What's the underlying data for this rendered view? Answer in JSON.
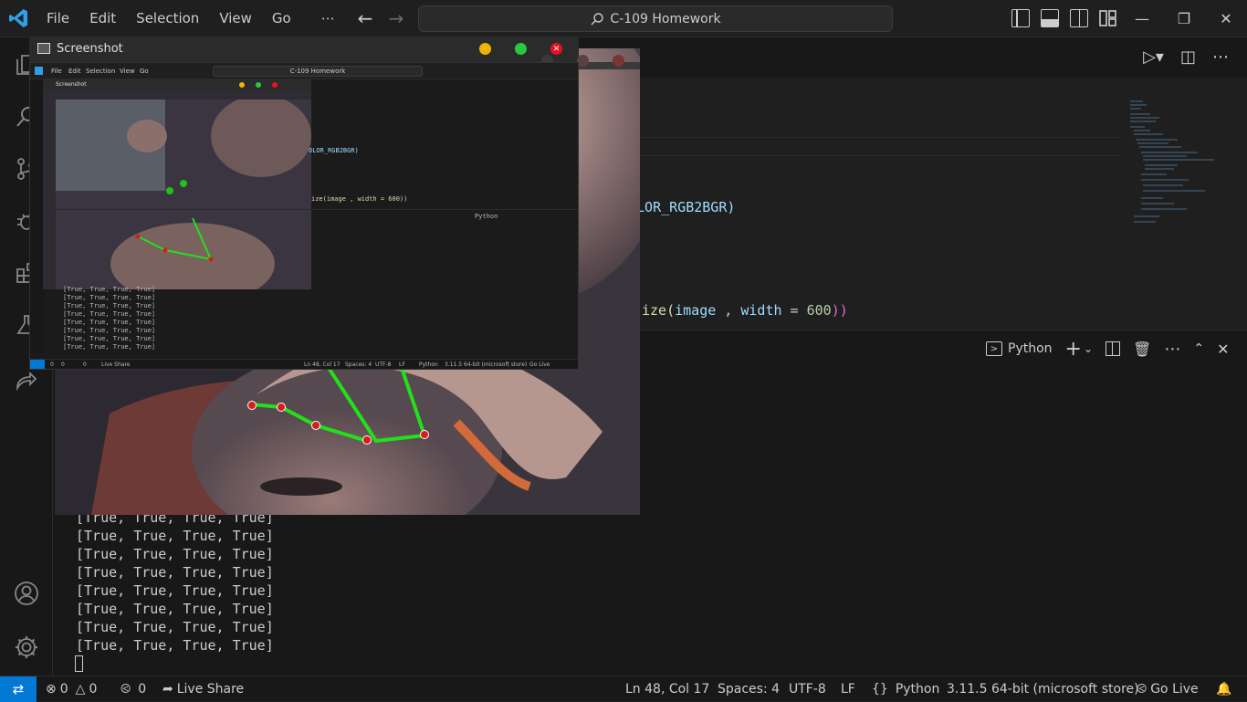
{
  "titlebar": {
    "menu": [
      "File",
      "Edit",
      "Selection",
      "View",
      "Go",
      "⋯"
    ],
    "search_text": "C-109 Homework"
  },
  "editor": {
    "code_fragment_1": "OLOR_RGB2BGR)",
    "code_fragment_2_prefix": "ize(",
    "code_fragment_2_image": "image",
    "code_fragment_2_mid": " , ",
    "code_fragment_2_width": "width",
    "code_fragment_2_eq": " = ",
    "code_fragment_2_num": "600",
    "code_fragment_2_end": "))"
  },
  "panel": {
    "terminal_label": "Python"
  },
  "terminal": {
    "lines": [
      "[True, True, True, True]",
      "[True, True, True, True]",
      "[True, True, True, True]",
      "[True, True, True, True]",
      "[True, True, True, True]",
      "[True, True, True, True]",
      "[True, True, True, True]",
      "[True, True, True, True]"
    ]
  },
  "statusbar": {
    "errors": "0",
    "warnings": "0",
    "ports": "0",
    "live_share": "Live Share",
    "cursor_position": "Ln 48, Col 17",
    "spaces": "Spaces: 4",
    "encoding": "UTF-8",
    "eol": "LF",
    "language": "Python",
    "interpreter": "3.11.5 64-bit (microsoft store)",
    "go_live": "Go Live"
  },
  "screenshot_window": {
    "title": "Screenshot",
    "inner": {
      "menu": [
        "File",
        "Edit",
        "Selection",
        "View",
        "Go"
      ],
      "search_text": "C-109 Homework",
      "title": "Screenshot",
      "code_1": "OLOR_RGB2BGR)",
      "code_2": "ize(image , width = 600))",
      "panel_label": "Python",
      "terminal_lines": [
        "[True, True, True, True]",
        "[True, True, True, True]",
        "[True, True, True, True]",
        "[True, True, True, True]",
        "[True, True, True, True]",
        "[True, True, True, True]",
        "[True, True, True, True]",
        "[True, True, True, True]"
      ],
      "status_errors": "0",
      "status_warnings": "0",
      "status_ports": "0",
      "status_live_share": "Live Share",
      "status_cursor": "Ln 48, Col 17",
      "status_spaces": "Spaces: 4",
      "status_encoding": "UTF-8",
      "status_eol": "LF",
      "status_language": "Python",
      "status_interpreter": "3.11.5 64-bit (microsoft store)",
      "status_go_live": "Go Live"
    }
  },
  "colors": {
    "accent": "#0078d4",
    "landmark_line": "#22e01a",
    "landmark_point": "#d81b1b",
    "dot_yellow": "#f0b400",
    "dot_green": "#28c840",
    "dot_red": "#e81123"
  }
}
